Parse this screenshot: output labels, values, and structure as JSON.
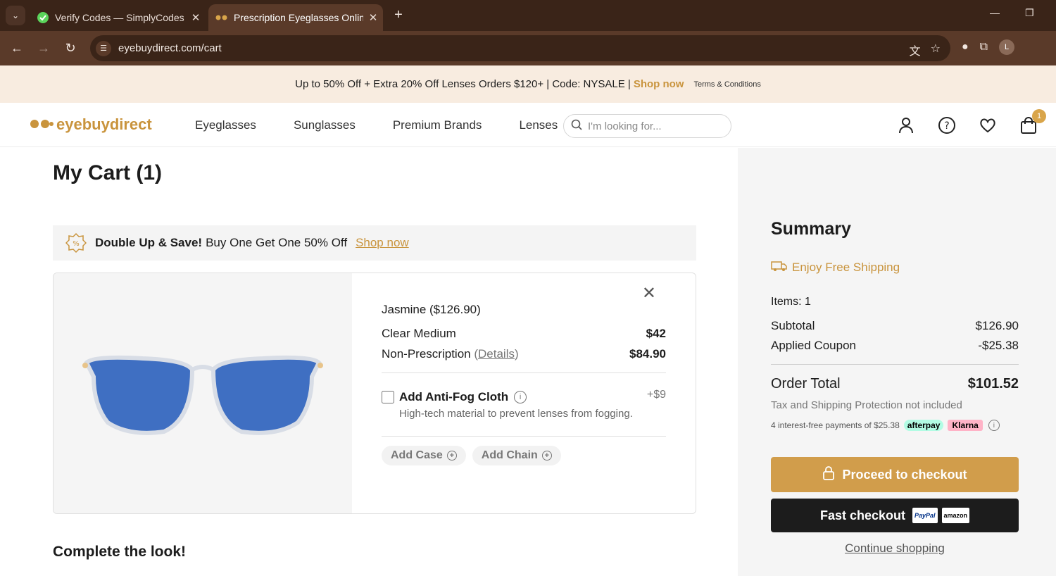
{
  "browser": {
    "tabs": [
      {
        "title": "Verify Codes — SimplyCodes"
      },
      {
        "title": "Prescription Eyeglasses Online I"
      }
    ],
    "url": "eyebuydirect.com/cart",
    "profile_initial": "L"
  },
  "promo": {
    "text": "Up to 50% Off + Extra 20% Off Lenses Orders $120+ | Code: NYSALE |",
    "shop_label": "Shop now",
    "terms_label": "Terms & Conditions"
  },
  "header": {
    "logo": "eyebuydirect",
    "nav": [
      "Eyeglasses",
      "Sunglasses",
      "Premium Brands",
      "Lenses"
    ],
    "search_placeholder": "I'm looking for...",
    "cart_count": "1"
  },
  "cart": {
    "title": "My Cart (1)",
    "bogo": {
      "bold": "Double Up & Save!",
      "text": "Buy One Get One 50% Off",
      "link": "Shop now"
    },
    "item": {
      "name": "Jasmine ($126.90)",
      "lines": [
        {
          "label": "Clear Medium",
          "price": "$42"
        },
        {
          "label": "Non-Prescription",
          "details": "Details",
          "price": "$84.90"
        }
      ],
      "antifog": {
        "label": "Add Anti-Fog Cloth",
        "price": "+$9",
        "desc": "High-tech material to prevent lenses from fogging."
      },
      "addons": [
        "Add Case",
        "Add Chain"
      ]
    },
    "complete_title": "Complete the look!"
  },
  "summary": {
    "title": "Summary",
    "free_shipping": "Enjoy Free Shipping",
    "items": "Items: 1",
    "subtotal_label": "Subtotal",
    "subtotal": "$126.90",
    "coupon_label": "Applied Coupon",
    "coupon": "-$25.38",
    "total_label": "Order Total",
    "total": "$101.52",
    "tax_note": "Tax and Shipping Protection not included",
    "installments": "4 interest-free payments of $25.38",
    "afterpay": "afterpay",
    "klarna": "Klarna",
    "checkout_label": "Proceed to checkout",
    "fast_label": "Fast checkout",
    "paypal": "PayPal",
    "amazon": "amazon",
    "continue_label": "Continue shopping"
  },
  "colors": {
    "accent": "#c9943d",
    "checkout": "#d19d4b",
    "browser_frame": "#3a2418"
  }
}
